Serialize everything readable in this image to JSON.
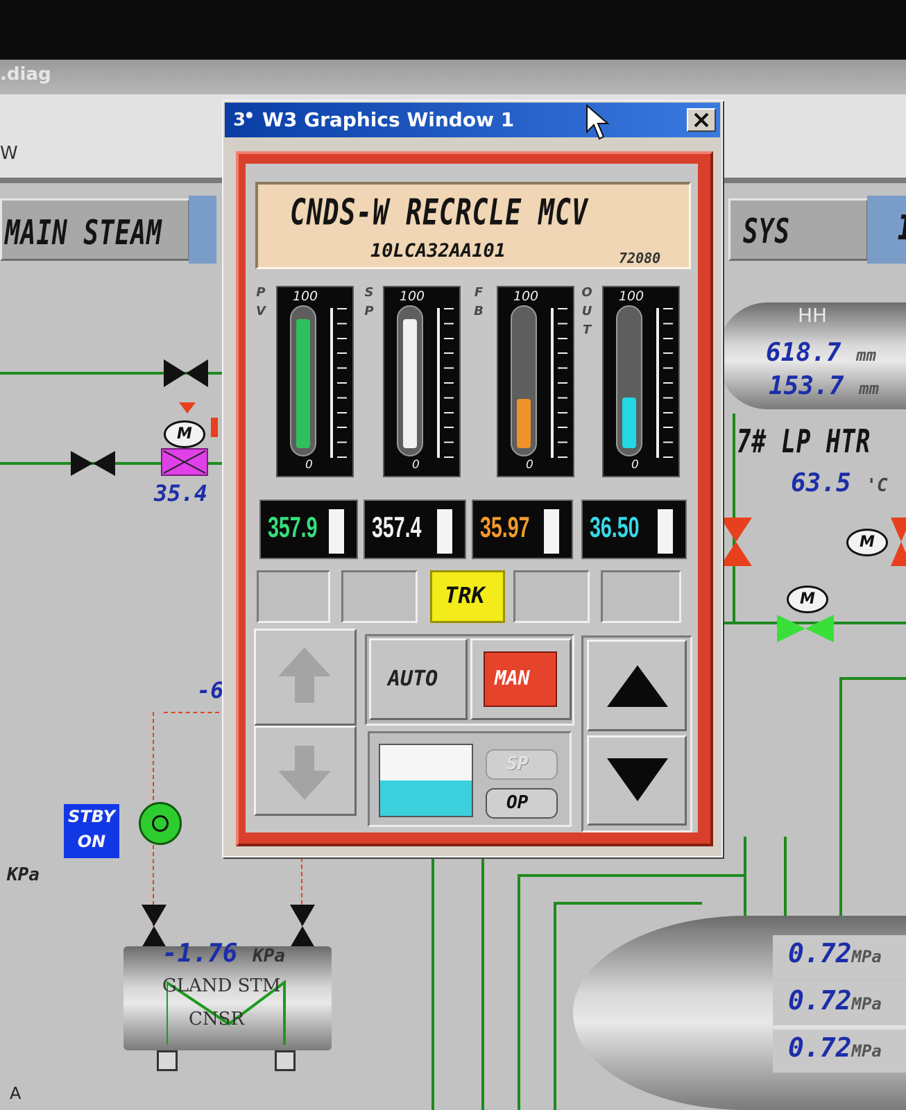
{
  "background_window": {
    "file_title": ".diag",
    "row2_text": "W",
    "tabs": {
      "main_steam": "MAIN STEAM",
      "sys": "SYS",
      "edge": "I"
    },
    "readings": {
      "valve_value": "35.4",
      "level_1": {
        "value": "618.7",
        "unit": "mm"
      },
      "level_2": {
        "value": "153.7",
        "unit": "mm"
      },
      "heater_label": "7# LP HTR",
      "heater_temp": {
        "value": "63.5",
        "unit": "'C"
      },
      "partial_value": "-6",
      "kpa_label": "KPa",
      "gland_pressure": {
        "value": "-1.76",
        "unit": "KPa"
      },
      "gland_label_1": "GLAND STM",
      "gland_label_2": "CNSR",
      "mpa_1": {
        "value": "0.72",
        "unit": "MPa"
      },
      "mpa_2": {
        "value": "0.72",
        "unit": "MPa"
      },
      "mpa_3": {
        "value": "0.72",
        "unit": "MPa"
      },
      "corner_letter": "A",
      "hh_label": "HH",
      "motor_letter": "M"
    },
    "stby_badge": {
      "line1": "STBY",
      "line2": "ON"
    }
  },
  "popup": {
    "title": "W3 Graphics Window 1",
    "app_icon_text": "3",
    "header": {
      "name": "CNDS-W RECRCLE MCV",
      "tag": "10LCA32AA101",
      "number": "72080"
    },
    "gauges": [
      {
        "label_chars": [
          "P",
          "V"
        ],
        "top": "100",
        "bottom": "0",
        "fill_fraction": 0.94,
        "fill_color": "#2ec05a",
        "value": "357.9",
        "value_color": "#34e07a"
      },
      {
        "label_chars": [
          "S",
          "P"
        ],
        "top": "100",
        "bottom": "0",
        "fill_fraction": 0.94,
        "fill_color": "#f0f0f0",
        "value": "357.4",
        "value_color": "#f2f2f2"
      },
      {
        "label_chars": [
          "F",
          "B"
        ],
        "top": "100",
        "bottom": "0",
        "fill_fraction": 0.36,
        "fill_color": "#f0922a",
        "value": "35.97",
        "value_color": "#f29a2e"
      },
      {
        "label_chars": [
          "O",
          "U",
          "T"
        ],
        "top": "100",
        "bottom": "0",
        "fill_fraction": 0.37,
        "fill_color": "#22d8e4",
        "value": "36.50",
        "value_color": "#38d8e6"
      }
    ],
    "status": {
      "trk_label": "TRK"
    },
    "buttons": {
      "auto": "AUTO",
      "man": "MAN",
      "sp": "SP",
      "op": "OP"
    },
    "mini_bar": {
      "fill_fraction": 0.5,
      "fill_color": "#3ccfdc"
    },
    "colors": {
      "frame_red": "#d8402c",
      "header_bg": "#f0d6b4",
      "trk_yellow": "#f4ec1a",
      "man_red": "#e6432c",
      "titlebar_blue": "#1a4fb4"
    }
  }
}
